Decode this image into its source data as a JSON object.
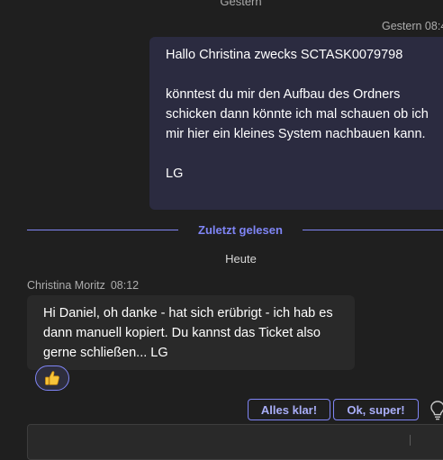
{
  "chat": {
    "day_label_yesterday": "Gestern",
    "sent_message": {
      "timestamp": "Gestern 08:4",
      "paragraphs": [
        "Hallo Christina zwecks SCTASK0079798",
        "könntest du mir den Aufbau des Ordners schicken dann könnte ich mal schauen ob ich mir hier ein kleines System nachbauen kann.",
        "LG"
      ]
    },
    "read_marker": "Zuletzt gelesen",
    "day_label_today": "Heute",
    "received_message": {
      "sender": "Christina Moritz",
      "time": "08:12",
      "text": "Hi Daniel, oh danke - hat sich erübrigt - ich hab es dann manuell kopiert. Du kannst das Ticket also gerne schließen... LG",
      "reaction": {
        "emoji": "👍",
        "icon": "thumbs-up-icon"
      }
    }
  },
  "suggested_replies": [
    "Alles klar!",
    "Ok, super!"
  ],
  "compose": {
    "placeholder": ""
  },
  "colors": {
    "background": "#1f1f1f",
    "sent_bubble": "#2b2b40",
    "received_bubble": "#292929",
    "accent": "#7f85f5",
    "meta_text": "#adadad"
  }
}
